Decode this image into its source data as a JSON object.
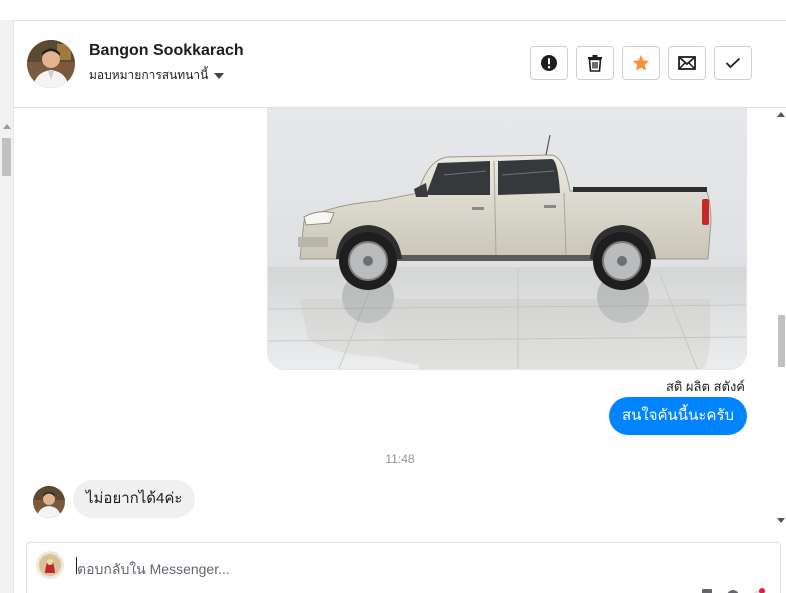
{
  "header": {
    "contact_name": "Bangon Sookkarach",
    "assign_label": "มอบหมายการสนทนานี้"
  },
  "actions": [
    {
      "name": "spam-button",
      "icon": "alert-circle-icon"
    },
    {
      "name": "delete-button",
      "icon": "trash-icon"
    },
    {
      "name": "star-button",
      "icon": "star-icon",
      "color": "#f7923b"
    },
    {
      "name": "mark-unread-button",
      "icon": "envelope-icon"
    },
    {
      "name": "mark-done-button",
      "icon": "checkmark-icon"
    }
  ],
  "chat": {
    "image_subject": "pickup-truck-photo",
    "sender_label": "สติ ผลิต สตังค์",
    "outgoing_message": "สนใจคันนี้นะครับ",
    "timestamp": "11:48",
    "incoming_message": "ไม่อยากได้4ค่ะ"
  },
  "composer": {
    "placeholder": "ตอบกลับใน Messenger..."
  },
  "colors": {
    "outgoing_bubble": "#0084ff",
    "incoming_bubble": "#f1f0f0",
    "star": "#f7923b"
  }
}
